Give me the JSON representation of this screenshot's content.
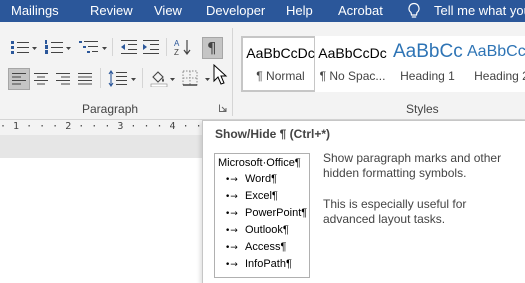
{
  "tabs": [
    "Mailings",
    "Review",
    "View",
    "Developer",
    "Help",
    "Acrobat"
  ],
  "tell_me": "Tell me what you",
  "groups": {
    "paragraph": "Paragraph",
    "styles": "Styles"
  },
  "show_hide_glyph": "¶",
  "styles": [
    {
      "sample": "AaBbCcDc",
      "name": "¶ Normal"
    },
    {
      "sample": "AaBbCcDc",
      "name": "¶ No Spac..."
    },
    {
      "sample": "AaBbCc",
      "name": "Heading 1"
    },
    {
      "sample": "AaBbCc",
      "name": "Heading 2"
    }
  ],
  "ruler": "· 1 · · · 2 · · · 3 · · · 4 · · · 5 · · · 6 · · · 7",
  "tooltip": {
    "title": "Show/Hide ¶ (Ctrl+*)",
    "description": "Show paragraph marks and other hidden formatting symbols.",
    "note": "This is especially useful for advanced layout tasks.",
    "preview_heading": "Microsoft·Office¶",
    "preview_items": [
      "Word¶",
      "Excel¶",
      "PowerPoint¶",
      "Outlook¶",
      "Access¶",
      "InfoPath¶"
    ],
    "preview_arrow": "•→"
  },
  "colors": {
    "ribbon_tab_bar": "#2b579a",
    "heading_blue": "#2e74b5",
    "ribbon_bg": "#f3f3f3",
    "hover_button": "#c5c5c5"
  },
  "icons": [
    "bullets-icon",
    "numbering-icon",
    "multilevel-list-icon",
    "decrease-indent-icon",
    "increase-indent-icon",
    "sort-icon",
    "show-hide-icon",
    "align-left-icon",
    "center-icon",
    "align-right-icon",
    "justify-icon",
    "line-spacing-icon",
    "shading-icon",
    "borders-icon",
    "lightbulb-icon",
    "mouse-pointer-icon",
    "dialog-launcher-icon"
  ]
}
